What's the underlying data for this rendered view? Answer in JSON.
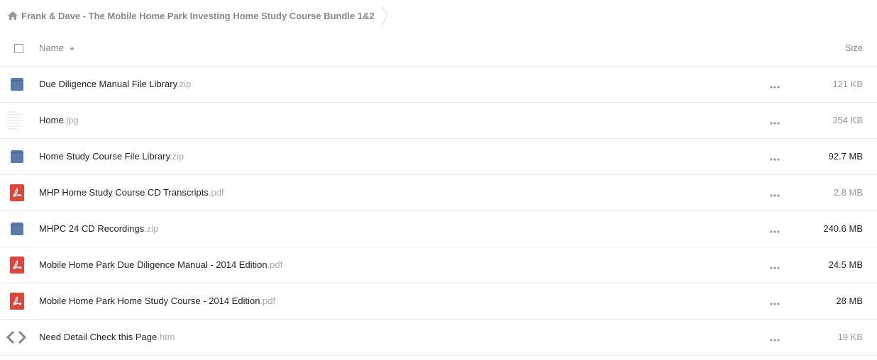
{
  "breadcrumb": {
    "icon": "home-icon",
    "label": "Frank & Dave - The Mobile Home Park Investing Home Study Course Bundle 1&2"
  },
  "header": {
    "name_label": "Name",
    "size_label": "Size",
    "sort_icon": "sort-asc-icon"
  },
  "colors": {
    "archive": "#5a7aa8",
    "pdf": "#e0443a",
    "muted": "#aaaaaa"
  },
  "files": [
    {
      "name": "Due Diligence Manual File Library",
      "ext": ".zip",
      "size": "121 KB",
      "type": "archive"
    },
    {
      "name": "Home",
      "ext": ".jpg",
      "size": "354 KB",
      "type": "image"
    },
    {
      "name": "Home Study Course File Library",
      "ext": ".zip",
      "size": "92.7 MB",
      "type": "archive"
    },
    {
      "name": "MHP Home Study Course CD Transcripts",
      "ext": ".pdf",
      "size": "2.8 MB",
      "type": "pdf"
    },
    {
      "name": "MHPC 24 CD Recordings",
      "ext": ".zip",
      "size": "240.6 MB",
      "type": "archive"
    },
    {
      "name": "Mobile Home Park Due Diligence Manual - 2014 Edition",
      "ext": ".pdf",
      "size": "24.5 MB",
      "type": "pdf"
    },
    {
      "name": "Mobile Home Park Home Study Course - 2014 Edition",
      "ext": ".pdf",
      "size": "28 MB",
      "type": "pdf"
    },
    {
      "name": "Need Detail Check this Page",
      "ext": ".htm",
      "size": "19 KB",
      "type": "code"
    }
  ]
}
